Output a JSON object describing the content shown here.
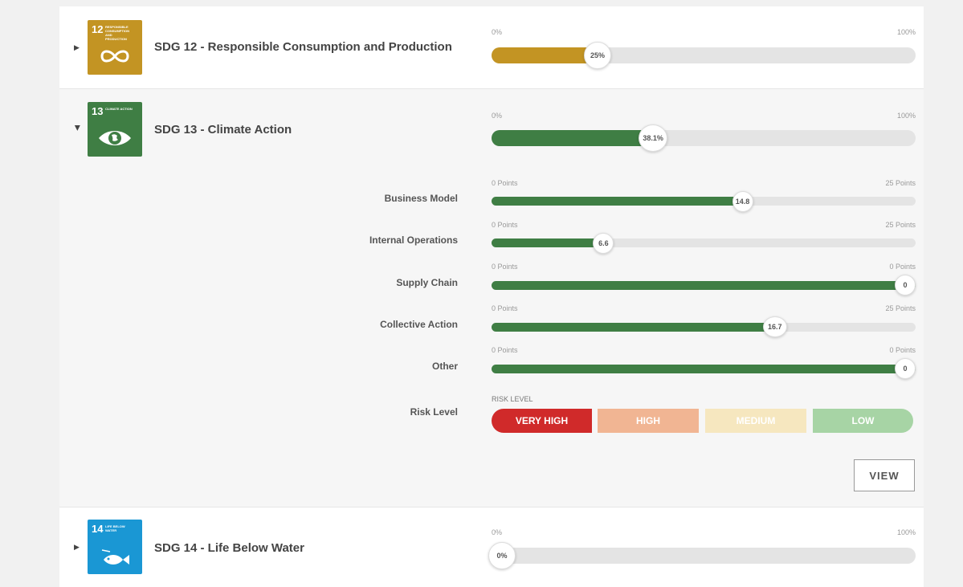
{
  "colors": {
    "sdg12": "#c39423",
    "sdg13": "#3f7e44",
    "sdg14": "#1a97d4",
    "track": "#e4e4e4",
    "risk_very_high": "#d02a2a",
    "risk_high": "#f1b593",
    "risk_medium": "#f6e7bf",
    "risk_low": "#a7d4a5"
  },
  "sdgs": [
    {
      "number": "12",
      "mini_text": "Responsible consumption and production",
      "icon": "infinity-icon",
      "title": "SDG 12 - Responsible Consumption and Production",
      "min_label": "0%",
      "max_label": "100%",
      "progress": 0.25,
      "value_label": "25%"
    },
    {
      "number": "13",
      "mini_text": "Climate action",
      "icon": "earth-eye-icon",
      "title": "SDG 13 - Climate Action",
      "min_label": "0%",
      "max_label": "100%",
      "progress": 0.381,
      "value_label": "38.1%"
    },
    {
      "number": "14",
      "mini_text": "Life below water",
      "icon": "fish-icon",
      "title": "SDG 14 - Life Below Water",
      "min_label": "0%",
      "max_label": "100%",
      "progress": 0.0,
      "value_label": "0%"
    }
  ],
  "details": [
    {
      "label": "Business Model",
      "min_label": "0 Points",
      "max_label": "25 Points",
      "value": 14.8,
      "max": 25,
      "value_label": "14.8"
    },
    {
      "label": "Internal Operations",
      "min_label": "0 Points",
      "max_label": "25 Points",
      "value": 6.6,
      "max": 25,
      "value_label": "6.6"
    },
    {
      "label": "Supply Chain",
      "min_label": "0 Points",
      "max_label": "0 Points",
      "value": 0,
      "max": 0,
      "value_label": "0"
    },
    {
      "label": "Collective Action",
      "min_label": "0 Points",
      "max_label": "25 Points",
      "value": 16.7,
      "max": 25,
      "value_label": "16.7"
    },
    {
      "label": "Other",
      "min_label": "0 Points",
      "max_label": "0 Points",
      "value": 0,
      "max": 0,
      "value_label": "0"
    }
  ],
  "risk": {
    "row_label": "Risk Level",
    "caption": "RISK LEVEL",
    "levels": [
      "VERY HIGH",
      "HIGH",
      "MEDIUM",
      "LOW"
    ],
    "selected": "VERY HIGH"
  },
  "view_button": "VIEW"
}
